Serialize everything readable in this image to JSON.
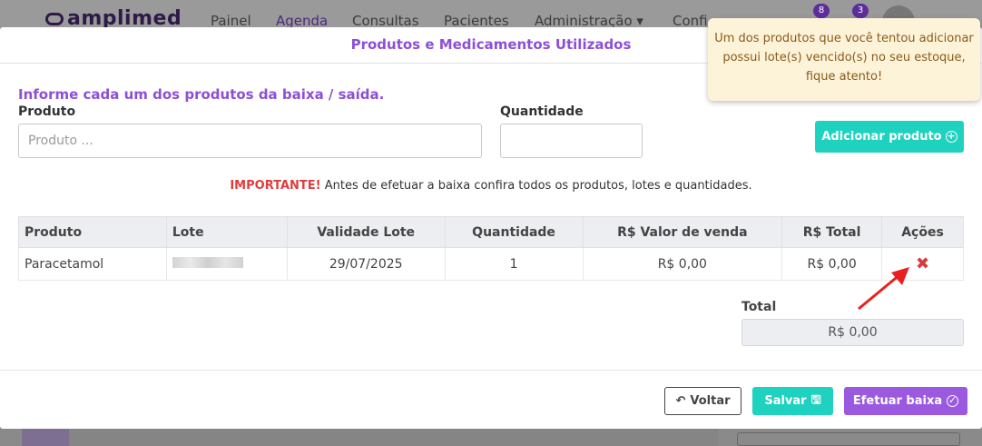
{
  "background": {
    "logo": "amplimed",
    "nav": [
      "Painel",
      "Agenda",
      "Consultas",
      "Pacientes",
      "Administração ▾",
      "Confi"
    ],
    "badges": [
      "8",
      "3"
    ]
  },
  "modal": {
    "title": "Produtos e Medicamentos Utilizados",
    "section_title": "Informe cada um dos produtos da baixa / saída.",
    "product_label": "Produto",
    "product_placeholder": "Produto ...",
    "qty_label": "Quantidade",
    "add_button": "Adicionar produto",
    "notice_strong": "IMPORTANTE!",
    "notice_text": " Antes de efetuar a baixa confira todos os produtos, lotes e quantidades.",
    "table": {
      "headers": [
        "Produto",
        "Lote",
        "Validade Lote",
        "Quantidade",
        "R$ Valor de venda",
        "R$ Total",
        "Ações"
      ],
      "rows": [
        {
          "produto": "Paracetamol",
          "lote": "",
          "validade": "29/07/2025",
          "quantidade": "1",
          "valor": "R$ 0,00",
          "total": "R$ 0,00"
        }
      ]
    },
    "total_label": "Total",
    "total_value": "R$ 0,00",
    "buttons": {
      "back": "Voltar",
      "save": "Salvar",
      "finish": "Efetuar baixa"
    }
  },
  "toast": {
    "message": "Um dos produtos que você tentou adicionar possui lote(s) vencido(s) no seu estoque, fique atento!"
  },
  "colors": {
    "accent_purple": "#8e4fd6",
    "teal": "#1fd1bf",
    "danger": "#d9393b",
    "toast_bg": "#fdf3d9"
  }
}
